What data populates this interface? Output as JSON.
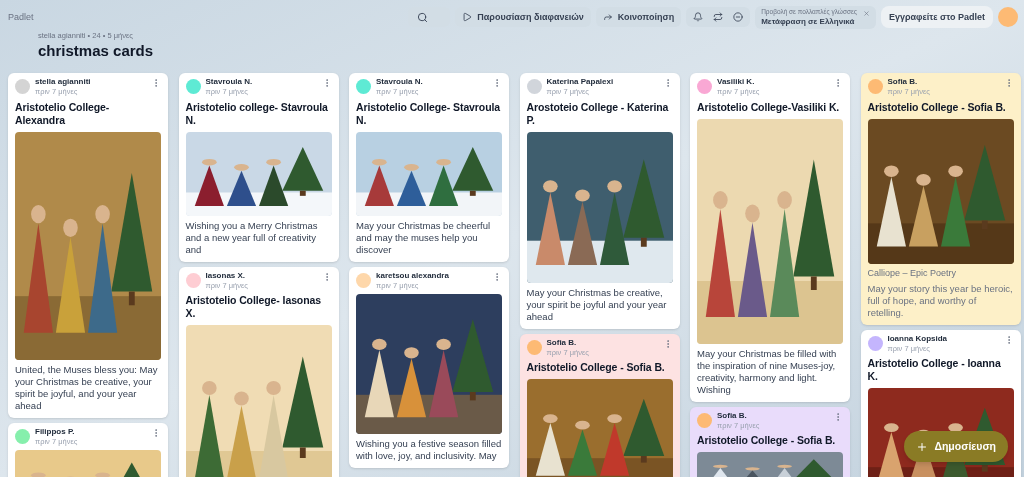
{
  "app": {
    "name": "Padlet"
  },
  "board": {
    "byline": "stella agianniti • 24 • 5 μήνες",
    "title": "christmas cards"
  },
  "toolbar": {
    "buttons": [
      {
        "kind": "slideshow",
        "label": "Παρουσίαση διαφανειών"
      },
      {
        "kind": "share",
        "label": "Κοινοποίηση"
      }
    ],
    "translate": {
      "hint": "Προβολή σε πολλαπλές γλώσσες",
      "label": "Μετάφραση σε Ελληνικά"
    },
    "signup": "Εγγραφείτε στο Padlet"
  },
  "columns": [
    [
      {
        "author": "stella agianniti",
        "time": "πριν 7 μήνες",
        "title": "Aristotelio College- Alexandra",
        "color": "#ffffff",
        "avatar": {
          "color": "#d4d4d4"
        },
        "body": "United, the Muses bless you: May your Christmas be creative, your spirit be joyful, and your year ahead"
      },
      {
        "author": "Filippos P.",
        "time": "πριν 7 μήνες",
        "color": "#ffffff",
        "avatar": {
          "color": "#86efac"
        }
      }
    ],
    [
      {
        "author": "Stavroula N.",
        "time": "πριν 7 μήνες",
        "title": "Aristotelio college- Stavroula N.",
        "color": "#ffffff",
        "avatar": {
          "color": "#5eead4"
        },
        "body": "Wishing you a Merry Christmas and a new year full of creativity and"
      },
      {
        "author": "Iasonas X.",
        "time": "πριν 7 μήνες",
        "title": "Aristotelio College- Iasonas X.",
        "color": "#ffffff",
        "avatar": {
          "color": "#fecdd3"
        }
      }
    ],
    [
      {
        "author": "Stavroula N.",
        "time": "πριν 7 μήνες",
        "title": "Aristotelio College- Stavroula N.",
        "color": "#ffffff",
        "avatar": {
          "color": "#5eead4"
        },
        "body": "May your Christmas be cheerful and may the muses help you discover"
      },
      {
        "author": "karetsou alexandra",
        "time": "πριν 7 μήνες",
        "color": "#ffffff",
        "avatar": {
          "color": "#fed7aa"
        },
        "body": "Wishing you a festive season filled with love, joy, and inclusivity. May"
      }
    ],
    [
      {
        "author": "Katerina Papalexi",
        "time": "πριν 7 μήνες",
        "title": "Arostoteio College - Katerina P.",
        "color": "#ffffff",
        "avatar": {
          "color": "#d1d5db"
        },
        "body": "May your Christmas be creative, your spirit be joyful and your year ahead"
      },
      {
        "author": "Sofia B.",
        "time": "πριν 7 μήνες",
        "title": "Aristotelio College - Sofia B.",
        "color": "#fde2e2",
        "avatar": {
          "color": "#fdba74"
        }
      }
    ],
    [
      {
        "author": "Vasiliki K.",
        "time": "πριν 7 μήνες",
        "title": "Aristotelio College-Vasiliki K.",
        "color": "#ffffff",
        "avatar": {
          "color": "#f9a8d4"
        },
        "body": "May your Christmas be filled with the inspiration of nine Muses-joy, creativity, harmony and light. Wishing"
      },
      {
        "author": "Sofia B.",
        "time": "πριν 7 μήνες",
        "title": "Aristotelio College - Sofia B.",
        "color": "#e9dcfb",
        "avatar": {
          "color": "#fdba74"
        }
      }
    ],
    [
      {
        "author": "Sofia B.",
        "time": "πριν 7 μήνες",
        "title": "Aristotelio College - Sofia B.",
        "color": "#fdf0c8",
        "avatar": {
          "color": "#fdba74"
        },
        "caption": "Calliope – Epic Poetry",
        "body": "May your story this year be heroic, full of hope, and worthy of retelling."
      },
      {
        "author": "Ioanna Kopsida",
        "time": "πριν 7 μήνες",
        "title": "Aristotelio College - Ioanna K.",
        "color": "#ffffff",
        "avatar": {
          "color": "#c4b5fd"
        }
      }
    ]
  ],
  "post_button": {
    "label": "Δημοσίευση"
  }
}
